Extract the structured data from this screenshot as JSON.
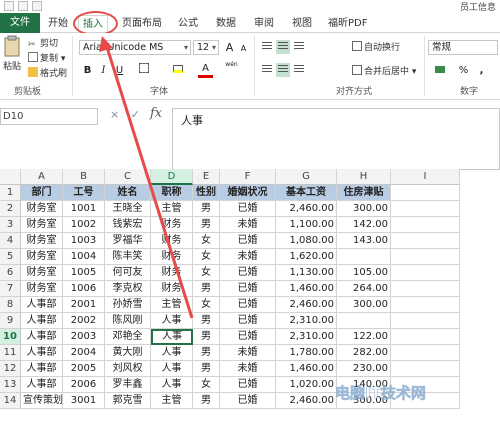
{
  "title_bar": {
    "doc_title": "员工信息"
  },
  "tabs": [
    {
      "label": "文件"
    },
    {
      "label": "开始"
    },
    {
      "label": "插入"
    },
    {
      "label": "页面布局"
    },
    {
      "label": "公式"
    },
    {
      "label": "数据"
    },
    {
      "label": "审阅"
    },
    {
      "label": "视图"
    },
    {
      "label": "福昕PDF"
    }
  ],
  "ribbon": {
    "clipboard": {
      "paste": "粘贴",
      "cut": "剪切",
      "copy": "复制",
      "format_painter": "格式刷",
      "group": "剪贴板"
    },
    "font": {
      "name": "Arial Unicode MS",
      "size": "12",
      "bold": "B",
      "italic": "I",
      "underline": "U",
      "grow": "A",
      "shrink": "A",
      "wen": "wén",
      "group": "字体"
    },
    "alignment": {
      "wrap": "自动换行",
      "merge": "合并后居中",
      "group": "对齐方式"
    },
    "number": {
      "format": "常规",
      "percent": "%",
      "comma": ",",
      "group": "数字"
    }
  },
  "formula_bar": {
    "name_box": "D10",
    "cancel": "×",
    "enter": "✓",
    "fx": "fx",
    "content": "人事"
  },
  "sheet": {
    "columns": [
      "A",
      "B",
      "C",
      "D",
      "E",
      "F",
      "G",
      "H",
      "I"
    ],
    "header_row": [
      "部门",
      "工号",
      "姓名",
      "职称",
      "性别",
      "婚姻状况",
      "基本工资",
      "住房津贴"
    ],
    "rows": [
      {
        "n": "2",
        "cells": [
          "财务室",
          "1001",
          "王晓全",
          "主管",
          "男",
          "已婚",
          "2,460.00",
          "300.00"
        ]
      },
      {
        "n": "3",
        "cells": [
          "财务室",
          "1002",
          "钱紫宏",
          "财务",
          "男",
          "未婚",
          "1,100.00",
          "142.00"
        ]
      },
      {
        "n": "4",
        "cells": [
          "财务室",
          "1003",
          "罗福华",
          "财务",
          "女",
          "已婚",
          "1,080.00",
          "143.00"
        ]
      },
      {
        "n": "5",
        "cells": [
          "财务室",
          "1004",
          "陈丰笑",
          "财务",
          "女",
          "未婚",
          "1,620.00",
          ""
        ]
      },
      {
        "n": "6",
        "cells": [
          "财务室",
          "1005",
          "何可友",
          "财务",
          "女",
          "已婚",
          "1,130.00",
          "105.00"
        ]
      },
      {
        "n": "7",
        "cells": [
          "财务室",
          "1006",
          "李克权",
          "财务",
          "男",
          "已婚",
          "1,460.00",
          "264.00"
        ]
      },
      {
        "n": "8",
        "cells": [
          "人事部",
          "2001",
          "孙娇雪",
          "主管",
          "女",
          "已婚",
          "2,460.00",
          "300.00"
        ]
      },
      {
        "n": "9",
        "cells": [
          "人事部",
          "2002",
          "陈风刚",
          "人事",
          "男",
          "已婚",
          "2,310.00",
          ""
        ]
      },
      {
        "n": "10",
        "cells": [
          "人事部",
          "2003",
          "邓艳全",
          "人事",
          "男",
          "已婚",
          "2,310.00",
          "122.00"
        ]
      },
      {
        "n": "11",
        "cells": [
          "人事部",
          "2004",
          "黄大刚",
          "人事",
          "男",
          "未婚",
          "1,780.00",
          "282.00"
        ]
      },
      {
        "n": "12",
        "cells": [
          "人事部",
          "2005",
          "刘风权",
          "人事",
          "男",
          "未婚",
          "1,460.00",
          "230.00"
        ]
      },
      {
        "n": "13",
        "cells": [
          "人事部",
          "2006",
          "罗丰鑫",
          "人事",
          "女",
          "已婚",
          "1,020.00",
          "140.00"
        ]
      },
      {
        "n": "14",
        "cells": [
          "宣传策划",
          "3001",
          "郭克雪",
          "主管",
          "男",
          "已婚",
          "2,460.00",
          "300.00"
        ]
      }
    ]
  },
  "watermark": "电脑IT技术网",
  "colors": {
    "excel_green": "#217346",
    "header_fill": "#b8cce4",
    "annotation_red": "#e84a4a"
  }
}
